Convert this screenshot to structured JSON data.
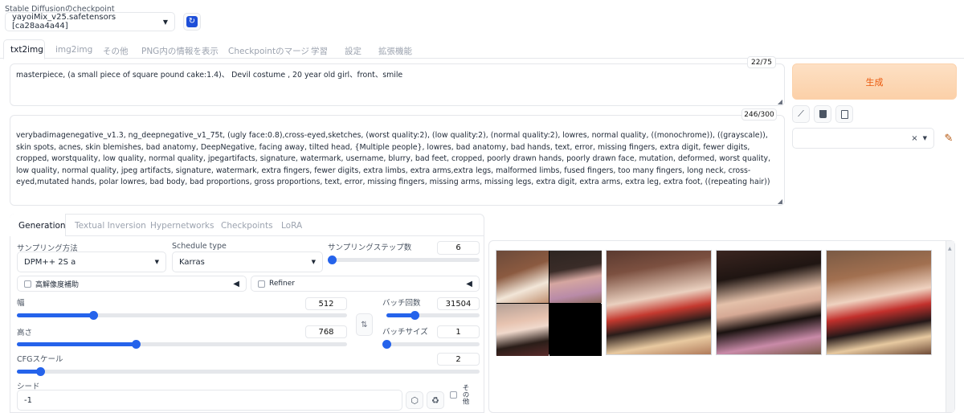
{
  "checkpoint": {
    "label": "Stable Diffusionのcheckpoint",
    "value": "yayoiMix_v25.safetensors [ca28aa4a44]"
  },
  "tabs": [
    "txt2img",
    "img2img",
    "その他",
    "PNG内の情報を表示",
    "Checkpointのマージ",
    "学習",
    "設定",
    "拡張機能"
  ],
  "prompt": {
    "counter": "22/75",
    "text": "masterpiece, (a small piece of square pound cake:1.4)、 Devil costume , 20 year old girl、front、smile"
  },
  "negative": {
    "counter": "246/300",
    "text": "verybadimagenegative_v1.3, ng_deepnegative_v1_75t, (ugly face:0.8),cross-eyed,sketches, (worst quality:2), (low quality:2), (normal quality:2), lowres, normal quality, ((monochrome)), ((grayscale)), skin spots, acnes, skin blemishes, bad anatomy, DeepNegative, facing away, tilted head, {Multiple people}, lowres, bad anatomy, bad hands, text, error, missing fingers, extra digit, fewer digits, cropped, worstquality, low quality, normal quality, jpegartifacts, signature, watermark, username, blurry, bad feet, cropped, poorly drawn hands, poorly drawn face, mutation, deformed, worst quality, low quality, normal quality, jpeg artifacts, signature, watermark, extra fingers, fewer digits, extra limbs, extra arms,extra legs, malformed limbs, fused fingers, too many fingers, long neck, cross-eyed,mutated hands, polar lowres, bad body, bad proportions, gross proportions, text, error, missing fingers, missing arms, missing legs, extra digit, extra arms, extra leg, extra foot, ((repeating hair))"
  },
  "generate_label": "生成",
  "subtabs": [
    "Generation",
    "Textual Inversion",
    "Hypernetworks",
    "Checkpoints",
    "LoRA"
  ],
  "sampling": {
    "method_label": "サンプリング方法",
    "method_value": "DPM++ 2S a",
    "schedule_label": "Schedule type",
    "schedule_value": "Karras",
    "steps_label": "サンプリングステップ数",
    "steps_value": "6",
    "steps_fraction": 0.0
  },
  "hires_label": "高解像度補助",
  "refiner_label": "Refiner",
  "width": {
    "label": "幅",
    "value": "512",
    "fraction": 0.23
  },
  "height": {
    "label": "高さ",
    "value": "768",
    "fraction": 0.36
  },
  "batch_count": {
    "label": "バッチ回数",
    "value": "31504",
    "fraction": 0.3
  },
  "batch_size": {
    "label": "バッチサイズ",
    "value": "1",
    "fraction": 0.0
  },
  "cfg": {
    "label": "CFGスケール",
    "value": "2",
    "fraction": 0.05
  },
  "seed": {
    "label": "シード",
    "value": "-1",
    "extra_label": "その他"
  },
  "colors": {
    "accent": "#2563eb",
    "generate_bg": "#fdd7b5",
    "generate_text": "#ea580c"
  }
}
